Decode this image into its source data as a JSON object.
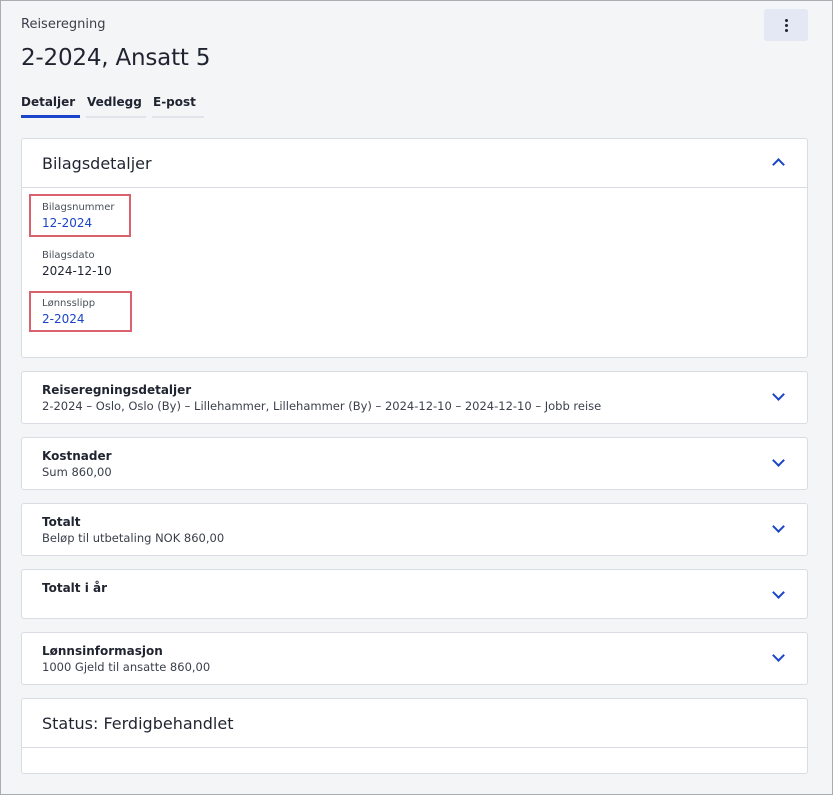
{
  "header": {
    "breadcrumb": "Reiseregning",
    "title": "2-2024, Ansatt 5"
  },
  "tabs": [
    {
      "label": "Detaljer",
      "active": true
    },
    {
      "label": "Vedlegg",
      "active": false
    },
    {
      "label": "E-post",
      "active": false
    }
  ],
  "voucher": {
    "heading": "Bilagsdetaljer",
    "fields": [
      {
        "label": "Bilagsnummer",
        "value": "12-2024"
      },
      {
        "label": "Bilagsdato",
        "value": "2024-12-10"
      },
      {
        "label": "Lønnsslipp",
        "value": "2-2024"
      }
    ]
  },
  "sections": [
    {
      "title": "Reiseregningsdetaljer",
      "summary": "2-2024  –  Oslo, Oslo (By)  –  Lillehammer, Lillehammer (By)  –  2024-12-10  –  2024-12-10  –  Jobb reise"
    },
    {
      "title": "Kostnader",
      "summary": "Sum 860,00"
    },
    {
      "title": "Totalt",
      "summary": "Beløp til utbetaling NOK 860,00"
    },
    {
      "title": "Totalt i år",
      "summary": ""
    },
    {
      "title": "Lønnsinformasjon",
      "summary": "1000 Gjeld til ansatte 860,00"
    }
  ],
  "status": {
    "heading": "Status: Ferdigbehandlet"
  },
  "colors": {
    "accent": "#1a44c9",
    "highlight": "#d9626e"
  },
  "icons": {
    "menu": "vertical-ellipsis-icon",
    "expanded": "chevron-up-icon",
    "collapsed": "chevron-down-icon"
  }
}
